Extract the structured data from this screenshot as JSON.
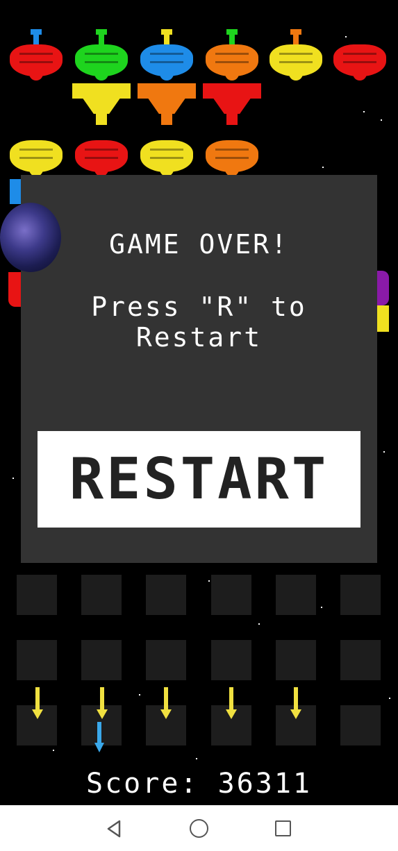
{
  "game": {
    "over_title": "GAME OVER!",
    "restart_hint": "Press \"R\" to Restart",
    "restart_button": "RESTART",
    "score_text": "Score: 36311"
  },
  "colors": {
    "red": "#e81414",
    "green": "#1ed41e",
    "blue": "#1e8ce8",
    "orange": "#f07810",
    "yellow": "#f0e020",
    "overlay": "#333333",
    "arrow": "#f0e040",
    "player_shot": "#3aa8ea"
  },
  "icons": {
    "nav_back": "back-triangle-icon",
    "nav_home": "home-circle-icon",
    "nav_recent": "recent-square-icon"
  }
}
